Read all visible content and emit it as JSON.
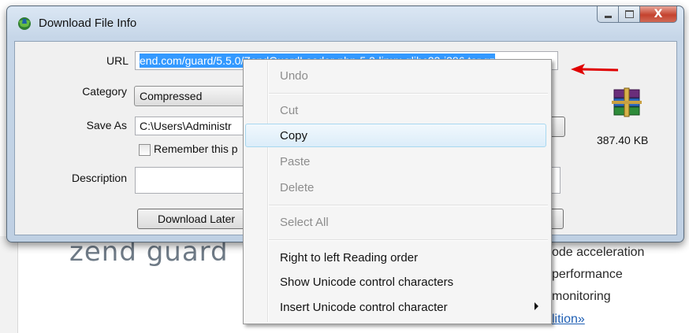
{
  "background": {
    "logo_text": "zend guard",
    "lines": [
      "code acceleration",
      "performance",
      "monitoring"
    ],
    "link_text": "lition»"
  },
  "window": {
    "title": "Download File Info",
    "controls": {
      "close": "X"
    }
  },
  "form": {
    "url_label": "URL",
    "url_value": "end.com/guard/5.5.0/ZendGuardLoader-php-5.3-linux-glibc23-i386.tar.gz",
    "category_label": "Category",
    "category_value": "Compressed",
    "save_as_label": "Save As",
    "save_as_value": "C:\\Users\\Administr",
    "remember_label": "Remember this p",
    "description_label": "Description",
    "description_value": "",
    "download_later_label": "Download Later",
    "file_size": "387.40  KB"
  },
  "context_menu": {
    "items": [
      {
        "label": "Undo",
        "enabled": false
      },
      {
        "label": "Cut",
        "enabled": false
      },
      {
        "label": "Copy",
        "enabled": true,
        "hovered": true
      },
      {
        "label": "Paste",
        "enabled": false
      },
      {
        "label": "Delete",
        "enabled": false
      },
      {
        "label": "Select All",
        "enabled": false
      },
      {
        "label": "Right to left Reading order",
        "enabled": true
      },
      {
        "label": "Show Unicode control characters",
        "enabled": true
      },
      {
        "label": "Insert Unicode control character",
        "enabled": true,
        "submenu": true
      }
    ]
  },
  "colors": {
    "selection": "#3399ff",
    "highlight": "#f5ff00",
    "arrow": "#e00000"
  }
}
